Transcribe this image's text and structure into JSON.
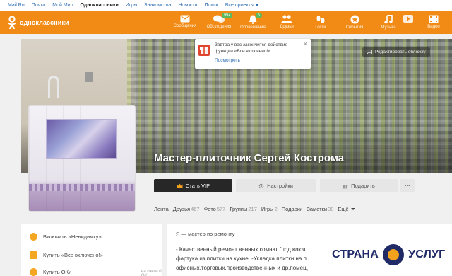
{
  "portal": {
    "links": [
      "Mail.Ru",
      "Почта",
      "Мой Мир",
      "Одноклассники",
      "Игры",
      "Знакомства",
      "Новости",
      "Поиск",
      "Все проекты"
    ],
    "active_index": 3
  },
  "toolbar": {
    "logo_text": "одноклассники",
    "items": [
      {
        "label": "Сообщения",
        "icon": "envelope-icon",
        "badge": ""
      },
      {
        "label": "Обсуждения",
        "icon": "chat-bubbles-icon",
        "badge": "99+"
      },
      {
        "label": "Оповещения",
        "icon": "bell-icon",
        "badge": "5"
      },
      {
        "label": "Друзья",
        "icon": "users-icon",
        "badge": ""
      },
      {
        "label": "Гости",
        "icon": "footprints-icon",
        "badge": ""
      },
      {
        "label": "События",
        "icon": "star-event-icon",
        "badge": ""
      },
      {
        "label": "Музыка",
        "icon": "music-note-icon",
        "badge": ""
      },
      {
        "label": "Видео",
        "icon": "video-icon",
        "badge": ""
      }
    ],
    "color": "#f28b16"
  },
  "cover": {
    "edit_label": "Редактировать обложку"
  },
  "promo": {
    "text": "Завтра у вас закончится действие функции «Все включено!»",
    "link": "Посмотреть"
  },
  "profile": {
    "name": "Мастер-плиточник Сергей Кострома"
  },
  "actions": {
    "vip": "Стать VIP",
    "settings": "Настройки",
    "gift": "Подарить",
    "more": "···"
  },
  "tabs": [
    {
      "label": "Лента",
      "count": ""
    },
    {
      "label": "Друзья",
      "count": "467"
    },
    {
      "label": "Фото",
      "count": "577"
    },
    {
      "label": "Группы",
      "count": "217"
    },
    {
      "label": "Игры",
      "count": "2"
    },
    {
      "label": "Подарки",
      "count": ""
    },
    {
      "label": "Заметки",
      "count": "38"
    },
    {
      "label": "Ещё",
      "count": ""
    }
  ],
  "sidebar": {
    "items": [
      {
        "label": "Включить «Невидимку»",
        "icon": "eye-icon",
        "meta": ""
      },
      {
        "label": "Купить «Все включено!»",
        "icon": "gift-box-icon",
        "meta": ""
      },
      {
        "label": "Купить ОКи",
        "icon": "ok-coin-icon",
        "meta": "на счете 0 ОК"
      }
    ]
  },
  "about": {
    "title": "Я — мастер по ремонту",
    "lines": [
      "- Качественный ремонт ванных комнат \"под ключ",
      "фартука из плитки на кухне. -Укладка плитки на п",
      "офисных,торговых,производственных и др.помещ"
    ]
  },
  "watermark": {
    "left": "СТРАНА",
    "right": "УСЛУГ"
  }
}
